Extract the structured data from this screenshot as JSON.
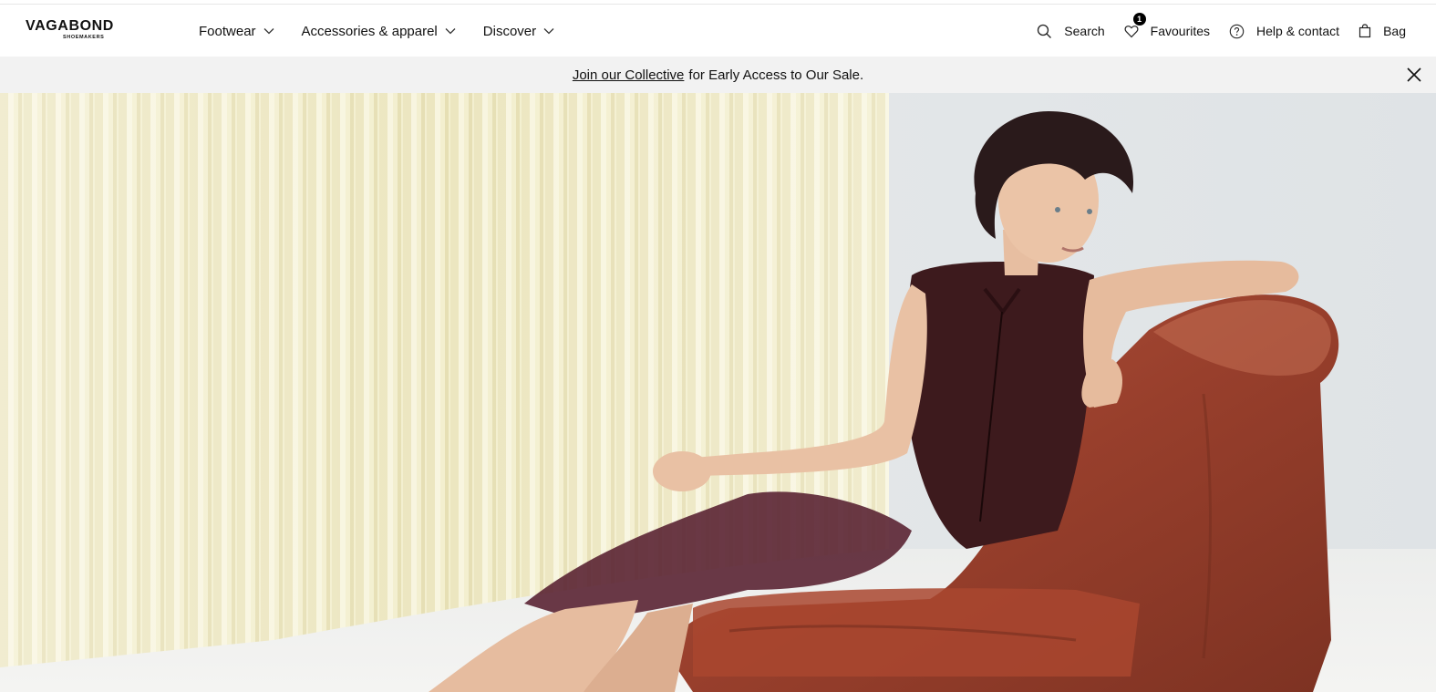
{
  "brand": {
    "name": "VAGABOND",
    "tagline": "SHOEMAKERS"
  },
  "nav": {
    "items": [
      {
        "label": "Footwear",
        "icon": "chevron-down-icon"
      },
      {
        "label": "Accessories & apparel",
        "icon": "chevron-down-icon"
      },
      {
        "label": "Discover",
        "icon": "chevron-down-icon"
      }
    ]
  },
  "utilities": {
    "search": {
      "label": "Search",
      "icon": "search-icon"
    },
    "favourites": {
      "label": "Favourites",
      "icon": "heart-icon",
      "count": "1"
    },
    "help": {
      "label": "Help & contact",
      "icon": "help-icon"
    },
    "bag": {
      "label": "Bag",
      "icon": "bag-icon"
    }
  },
  "promo": {
    "link_text": "Join our Collective",
    "text": "for Early Access to Our Sale.",
    "close_icon": "close-icon"
  },
  "colors": {
    "promo_bg": "#f2f2f2",
    "text": "#111111",
    "badge": "#000000"
  }
}
